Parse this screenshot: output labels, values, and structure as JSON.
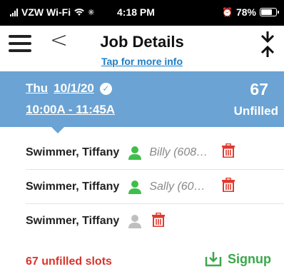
{
  "status_bar": {
    "carrier": "VZW Wi-Fi",
    "time": "4:18 PM",
    "battery": "78%",
    "battery_level": 0.78
  },
  "header": {
    "title": "Job Details",
    "subtitle": "Tap for more info"
  },
  "job": {
    "day": "Thu",
    "date": "10/1/20",
    "time_range": "10:00A - 11:45A",
    "unfilled_count": "67",
    "unfilled_label": "Unfilled"
  },
  "slots": [
    {
      "name": "Swimmer, Tiffany",
      "assignee": "Billy (608…",
      "status": "filled"
    },
    {
      "name": "Swimmer, Tiffany",
      "assignee": "Sally (60…",
      "status": "filled"
    },
    {
      "name": "Swimmer, Tiffany",
      "assignee": "",
      "status": "empty"
    }
  ],
  "footer": {
    "unfilled_text": "67 unfilled slots",
    "signup_label": "Signup"
  },
  "colors": {
    "banner": "#6ba3d4",
    "link": "#1e7fc4",
    "filled_person": "#3fbe4b",
    "empty_person": "#bfbfbf",
    "trash": "#e03a2f",
    "footer_red": "#d9342b",
    "signup_green": "#3aa84a"
  }
}
